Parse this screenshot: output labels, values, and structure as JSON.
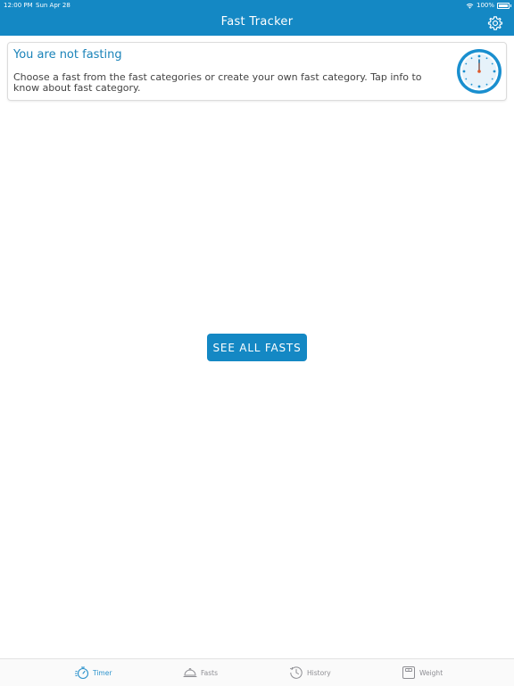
{
  "status_bar": {
    "time": "12:00 PM",
    "date": "Sun Apr 28",
    "battery": "100%"
  },
  "nav": {
    "title": "Fast Tracker",
    "settings_icon": "gear-icon"
  },
  "status_card": {
    "title": "You are not fasting",
    "description": "Choose a fast from the fast categories or create your own fast category. Tap info to know about fast category.",
    "icon": "clock-icon"
  },
  "main": {
    "see_all_label": "SEE ALL FASTS"
  },
  "tabs": [
    {
      "label": "Timer",
      "icon": "timer-icon",
      "active": true
    },
    {
      "label": "Fasts",
      "icon": "food-cover-icon",
      "active": false
    },
    {
      "label": "History",
      "icon": "history-icon",
      "active": false
    },
    {
      "label": "Weight",
      "icon": "scale-icon",
      "active": false
    }
  ],
  "colors": {
    "primary": "#1488c4",
    "accent_text": "#1a83b9",
    "tab_active": "#2b92cc",
    "tab_inactive": "#8e8e93"
  }
}
